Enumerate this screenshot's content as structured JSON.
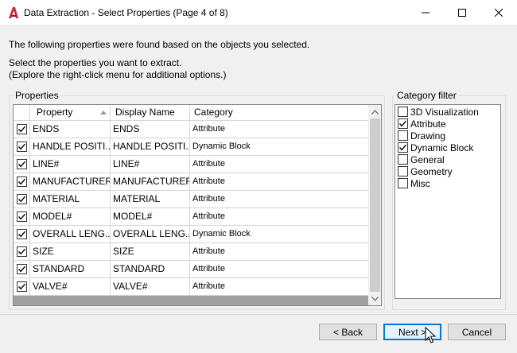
{
  "window": {
    "title": "Data Extraction - Select Properties (Page 4 of 8)",
    "minimize_glyph": "—",
    "maximize_glyph": "☐",
    "close_glyph": "✕"
  },
  "intro": {
    "line1": "The following properties were found based on the objects you selected.",
    "line2": "Select the properties you want to extract.",
    "line3": "(Explore the right-click menu for additional options.)"
  },
  "properties": {
    "group_label": "Properties",
    "columns": {
      "property": "Property",
      "display_name": "Display Name",
      "category": "Category"
    },
    "rows": [
      {
        "checked": true,
        "property": "ENDS",
        "display_name": "ENDS",
        "category": "Attribute"
      },
      {
        "checked": true,
        "property": "HANDLE POSITI...",
        "display_name": "HANDLE POSITI...",
        "category": "Dynamic Block"
      },
      {
        "checked": true,
        "property": "LINE#",
        "display_name": "LINE#",
        "category": "Attribute"
      },
      {
        "checked": true,
        "property": "MANUFACTURER",
        "display_name": "MANUFACTURER",
        "category": "Attribute"
      },
      {
        "checked": true,
        "property": "MATERIAL",
        "display_name": "MATERIAL",
        "category": "Attribute"
      },
      {
        "checked": true,
        "property": "MODEL#",
        "display_name": "MODEL#",
        "category": "Attribute"
      },
      {
        "checked": true,
        "property": "OVERALL LENG...",
        "display_name": "OVERALL LENG...",
        "category": "Dynamic Block"
      },
      {
        "checked": true,
        "property": "SIZE",
        "display_name": "SIZE",
        "category": "Attribute"
      },
      {
        "checked": true,
        "property": "STANDARD",
        "display_name": "STANDARD",
        "category": "Attribute"
      },
      {
        "checked": true,
        "property": "VALVE#",
        "display_name": "VALVE#",
        "category": "Attribute"
      }
    ]
  },
  "category_filter": {
    "group_label": "Category filter",
    "items": [
      {
        "label": "3D Visualization",
        "checked": false
      },
      {
        "label": "Attribute",
        "checked": true
      },
      {
        "label": "Drawing",
        "checked": false
      },
      {
        "label": "Dynamic Block",
        "checked": true
      },
      {
        "label": "General",
        "checked": false
      },
      {
        "label": "Geometry",
        "checked": false
      },
      {
        "label": "Misc",
        "checked": false
      }
    ]
  },
  "buttons": {
    "back": "< Back",
    "next": "Next >",
    "cancel": "Cancel"
  },
  "colors": {
    "app_icon": "#c8282d",
    "focus_border": "#0078d7"
  }
}
